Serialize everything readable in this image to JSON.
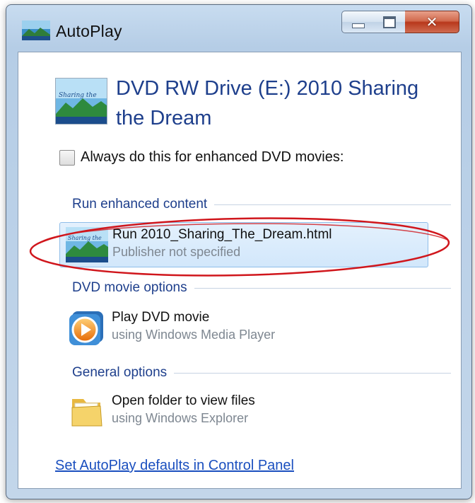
{
  "window": {
    "title": "AutoPlay",
    "controls": {
      "minimize": "minimize-icon",
      "maximize": "maximize-icon",
      "close": "close-icon"
    }
  },
  "device": {
    "title": "DVD RW Drive (E:) 2010 Sharing the Dream",
    "icon_text": "Sharing the"
  },
  "always": {
    "label": "Always do this for enhanced DVD movies:",
    "checked": false
  },
  "groups": [
    {
      "header": "Run enhanced content",
      "options": [
        {
          "primary": "Run 2010_Sharing_The_Dream.html",
          "secondary": "Publisher not specified",
          "icon": "sharing-the-dream-icon",
          "selected": true
        }
      ]
    },
    {
      "header": "DVD movie options",
      "options": [
        {
          "primary": "Play DVD movie",
          "secondary": "using Windows Media Player",
          "icon": "media-player-icon",
          "selected": false
        }
      ]
    },
    {
      "header": "General options",
      "options": [
        {
          "primary": "Open folder to view files",
          "secondary": "using Windows Explorer",
          "icon": "folder-icon",
          "selected": false
        }
      ]
    }
  ],
  "footer": {
    "link": "Set AutoPlay defaults in Control Panel"
  },
  "colors": {
    "accent": "#1e3f8c",
    "link": "#1a4fbf",
    "annotation": "#d0161c",
    "selection": "#d2e7fb"
  }
}
